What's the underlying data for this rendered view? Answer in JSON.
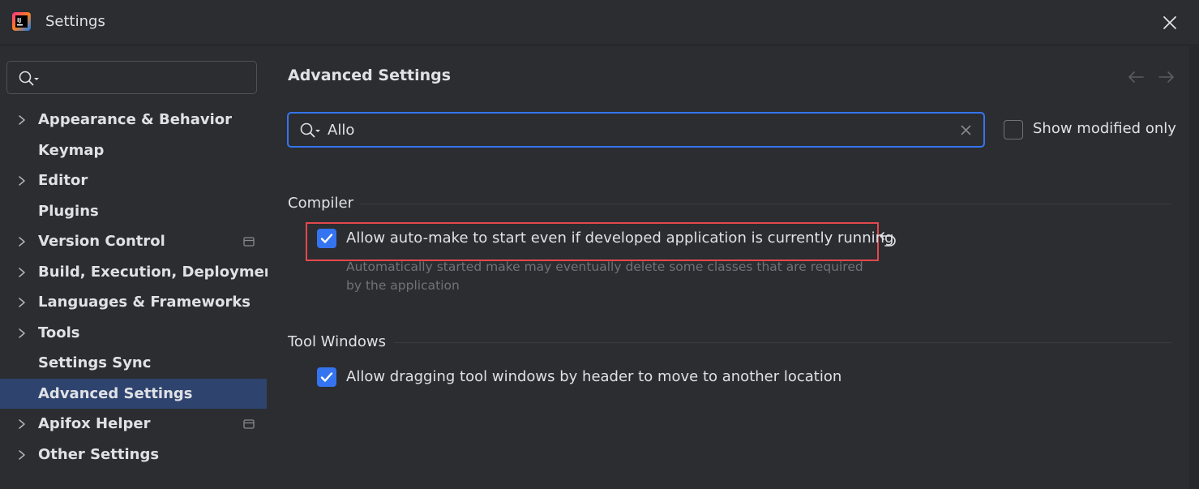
{
  "window": {
    "title": "Settings",
    "logo_text": "IJ",
    "close_icon": "close-icon"
  },
  "sidebar": {
    "search_placeholder": "",
    "items": [
      {
        "label": "Appearance & Behavior",
        "expandable": true,
        "badge": false,
        "selected": false
      },
      {
        "label": "Keymap",
        "expandable": false,
        "badge": false,
        "selected": false
      },
      {
        "label": "Editor",
        "expandable": true,
        "badge": false,
        "selected": false
      },
      {
        "label": "Plugins",
        "expandable": false,
        "badge": false,
        "selected": false
      },
      {
        "label": "Version Control",
        "expandable": true,
        "badge": true,
        "selected": false
      },
      {
        "label": "Build, Execution, Deployment",
        "expandable": true,
        "badge": false,
        "selected": false
      },
      {
        "label": "Languages & Frameworks",
        "expandable": true,
        "badge": false,
        "selected": false
      },
      {
        "label": "Tools",
        "expandable": true,
        "badge": false,
        "selected": false
      },
      {
        "label": "Settings Sync",
        "expandable": false,
        "badge": false,
        "selected": false
      },
      {
        "label": "Advanced Settings",
        "expandable": false,
        "badge": false,
        "selected": true
      },
      {
        "label": "Apifox Helper",
        "expandable": true,
        "badge": true,
        "selected": false
      },
      {
        "label": "Other Settings",
        "expandable": true,
        "badge": false,
        "selected": false
      }
    ]
  },
  "main": {
    "title": "Advanced Settings",
    "search": {
      "value": "Allo"
    },
    "show_modified": {
      "label": "Show modified only",
      "checked": false
    },
    "groups": [
      {
        "title": "Compiler",
        "options": [
          {
            "label": "Allow auto-make to start even if developed application is currently running",
            "checked": true,
            "description": "Automatically started make may eventually delete some classes that are required by the application",
            "modified": true
          }
        ]
      },
      {
        "title": "Tool Windows",
        "options": [
          {
            "label": "Allow dragging tool windows by header to move to another location",
            "checked": true
          }
        ]
      }
    ]
  },
  "colors": {
    "background": "#2b2d30",
    "accent": "#3574f0",
    "selection": "#2e436e",
    "highlight_border": "#e5484d",
    "muted_text": "#6f737a"
  }
}
